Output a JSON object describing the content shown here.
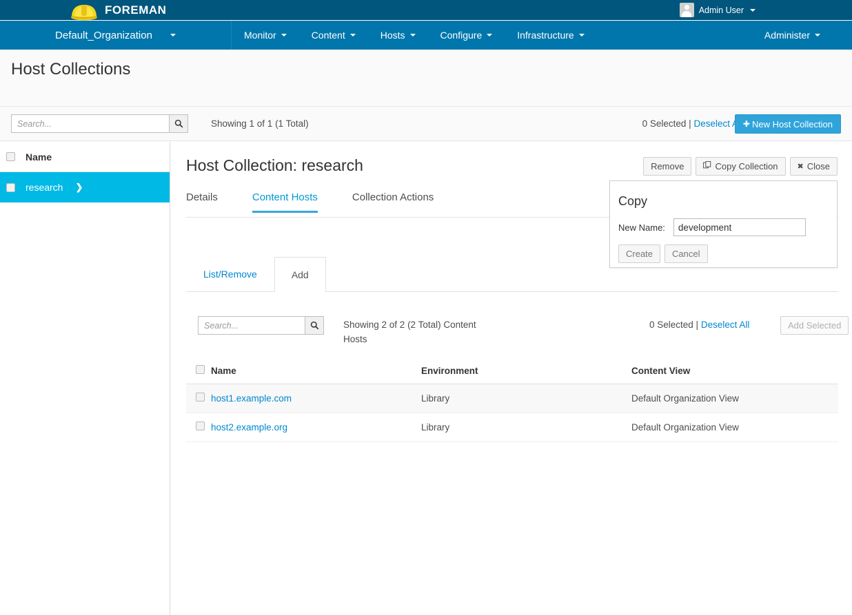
{
  "topbar": {
    "brand": "FOREMAN",
    "logo_icon": "hardhat-icon",
    "user": "Admin User",
    "user_icon": "avatar-icon",
    "caret_icon": "caret-down-icon"
  },
  "nav": {
    "organization": "Default_Organization",
    "items": [
      {
        "label": "Monitor"
      },
      {
        "label": "Content"
      },
      {
        "label": "Hosts"
      },
      {
        "label": "Configure"
      },
      {
        "label": "Infrastructure"
      }
    ],
    "right": {
      "label": "Administer"
    }
  },
  "page": {
    "title": "Host Collections"
  },
  "toolbar": {
    "search_placeholder": "Search...",
    "search_value": "",
    "search_icon": "search-icon",
    "showing": "Showing 1 of 1 (1 Total)",
    "selected_count": "0 Selected |",
    "deselect_all": "Deselect All",
    "new_button": "New Host Collection",
    "new_button_icon": "plus-icon"
  },
  "list": {
    "header_name": "Name",
    "rows": [
      {
        "name": "research",
        "selected": true,
        "chevron_icon": "chevron-right-icon"
      }
    ]
  },
  "detail": {
    "title": "Host Collection: research",
    "actions": [
      {
        "label": "Remove",
        "icon": null,
        "name": "remove-button"
      },
      {
        "label": "Copy Collection",
        "icon": "copy-icon",
        "name": "copy-collection-button"
      },
      {
        "label": "Close",
        "icon": "close-x-icon",
        "name": "close-button"
      }
    ],
    "tabs": [
      {
        "label": "Details",
        "active": false
      },
      {
        "label": "Content Hosts",
        "active": true
      },
      {
        "label": "Collection Actions",
        "active": false
      }
    ],
    "subtabs": [
      {
        "label": "List/Remove",
        "active": false
      },
      {
        "label": "Add",
        "active": true
      }
    ],
    "inner": {
      "search_placeholder": "Search...",
      "search_value": "",
      "search_icon": "search-icon",
      "showing": "Showing 2 of 2 (2 Total) Content Hosts",
      "selected_count": "0 Selected |",
      "deselect_all": "Deselect All",
      "add_selected": "Add Selected"
    },
    "table": {
      "columns": [
        "Name",
        "Environment",
        "Content View"
      ],
      "rows": [
        {
          "name": "host1.example.com",
          "environment": "Library",
          "content_view": "Default Organization View"
        },
        {
          "name": "host2.example.org",
          "environment": "Library",
          "content_view": "Default Organization View"
        }
      ]
    }
  },
  "popover": {
    "title": "Copy",
    "label": "New Name:",
    "value": "development",
    "placeholder": "",
    "create": "Create",
    "cancel": "Cancel"
  },
  "colors": {
    "topbar": "#01567d",
    "navbar": "#0076ac",
    "accent": "#0088ce",
    "selected_row": "#00b9e4",
    "primary_button": "#2fa4db",
    "tab_underline": "#39a5dc"
  }
}
